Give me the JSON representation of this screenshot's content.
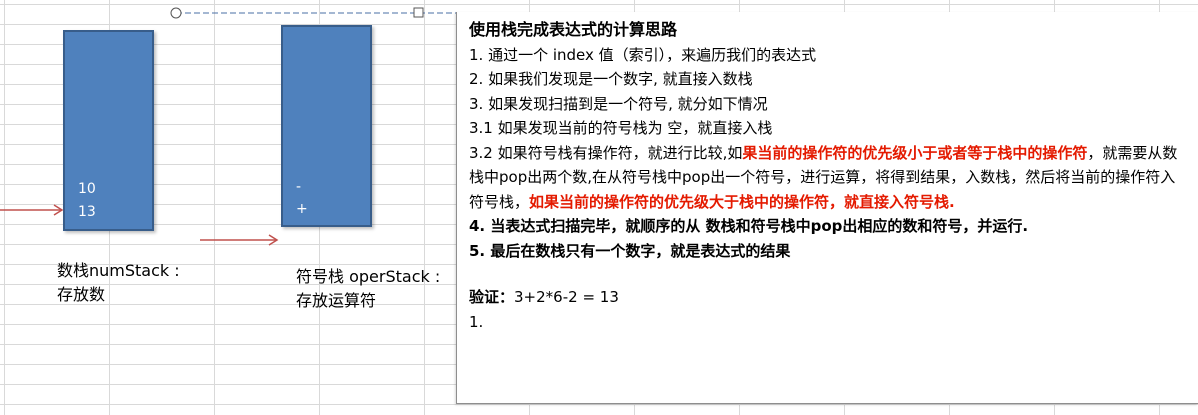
{
  "num_stack": {
    "items": [
      "10",
      "13"
    ],
    "caption_line1": "数栈numStack :",
    "caption_line2": "存放数"
  },
  "oper_stack": {
    "items": [
      "-",
      "+"
    ],
    "caption_line1": "符号栈 operStack :",
    "caption_line2": "存放运算符"
  },
  "colors": {
    "stack_fill": "#4f81bd",
    "stack_border": "#385d8a",
    "arrow": "#c0504d",
    "highlight": "#e41a00"
  },
  "note": {
    "title": "使用栈完成表达式的计算思路",
    "step1": "1. 通过一个 index  值（索引），来遍历我们的表达式",
    "step2": "2. 如果我们发现是一个数字, 就直接入数栈",
    "step3": "3. 如果发现扫描到是一个符号, 就分如下情况",
    "step3_1": "3.1 如果发现当前的符号栈为 空，就直接入栈",
    "step3_2_a": "3.2 如果符号栈有操作符，就进行比较,如",
    "step3_2_b": "果当前的操作符的优先级小于或者等于栈中的操作符",
    "step3_2_c": "，就需要从数栈中pop出两个数,在从符号栈中pop出一个符号，进行运算，将得到结果，入数栈，然后将当前的操作符入符号栈，",
    "step3_2_d": "如果当前的操作符的优先级大于栈中的操作符，就直接入符号栈",
    "step3_2_e": ".",
    "step4": "4. 当表达式扫描完毕，就顺序的从 数栈和符号栈中pop出相应的数和符号，并运行.",
    "step5": "5. 最后在数栈只有一个数字，就是表达式的结果",
    "verify_label": "验证：",
    "verify_expr": "3+2*6-2 = 13",
    "list_start": "1."
  }
}
